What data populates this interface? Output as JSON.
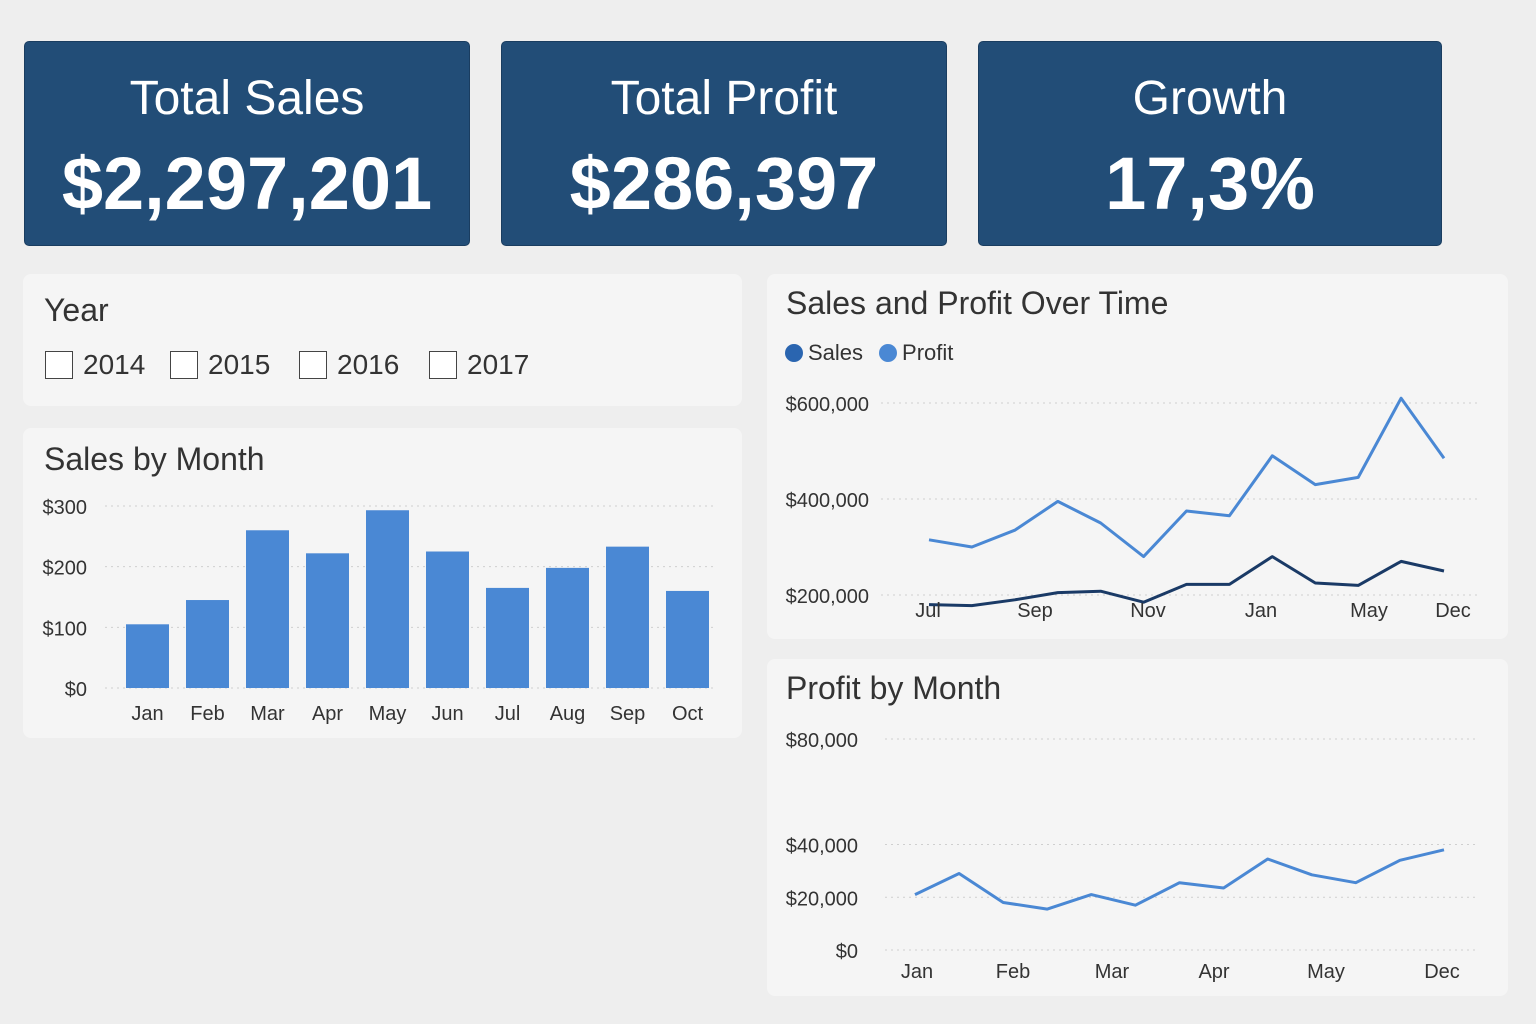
{
  "kpis": [
    {
      "label": "Total Sales",
      "value": "$2,297,201"
    },
    {
      "label": "Total Profit",
      "value": "$286,397"
    },
    {
      "label": "Growth",
      "value": "17,3%"
    }
  ],
  "year_filter": {
    "title": "Year",
    "options": [
      {
        "label": "2014",
        "checked": false
      },
      {
        "label": "2015",
        "checked": false
      },
      {
        "label": "2016",
        "checked": false
      },
      {
        "label": "2017",
        "checked": false
      }
    ]
  },
  "colors": {
    "kpi_bg": "#224d77",
    "bar": "#4a88d4",
    "sales_line": "#4a88d4",
    "profit_line": "#1a3a66",
    "legend_sales": "#2a65b0",
    "legend_profit": "#4a88d4"
  },
  "chart_data": [
    {
      "type": "bar",
      "title": "Sales by Month",
      "categories": [
        "Jan",
        "Feb",
        "Mar",
        "Apr",
        "May",
        "Jun",
        "Jul",
        "Aug",
        "Sep",
        "Oct"
      ],
      "values": [
        105,
        145,
        260,
        222,
        293,
        225,
        165,
        198,
        233,
        160
      ],
      "yticks": [
        "$0",
        "$100",
        "$200",
        "$300"
      ],
      "ylim": [
        0,
        300
      ],
      "grid": true
    },
    {
      "type": "line",
      "title": "Sales and Profit Over Time",
      "legend": [
        "Sales",
        "Profit"
      ],
      "legend_position": "top-left",
      "xticks": [
        "Jul",
        "Sep",
        "Nov",
        "Jan",
        "May",
        "Dec"
      ],
      "series": [
        {
          "name": "Sales",
          "values": [
            315000,
            300000,
            335000,
            395000,
            350000,
            280000,
            375000,
            365000,
            490000,
            430000,
            445000,
            610000,
            485000
          ]
        },
        {
          "name": "Profit",
          "values": [
            180000,
            178000,
            190000,
            205000,
            208000,
            185000,
            222000,
            222000,
            280000,
            225000,
            220000,
            270000,
            250000
          ]
        }
      ],
      "yticks": [
        "$200,000",
        "$400,000",
        "$600,000"
      ],
      "ylim": [
        100000,
        600000
      ],
      "grid": true
    },
    {
      "type": "line",
      "title": "Profit by Month",
      "xticks": [
        "Jan",
        "Feb",
        "Mar",
        "Apr",
        "May",
        "Dec"
      ],
      "series": [
        {
          "name": "Profit",
          "values": [
            21000,
            29000,
            18000,
            15500,
            21000,
            17000,
            25500,
            23500,
            34500,
            28500,
            25500,
            34000,
            38000
          ]
        }
      ],
      "yticks": [
        "$0",
        "$20,000",
        "$40,000",
        "$80,000"
      ],
      "ylim": [
        0,
        80000
      ],
      "grid": true
    }
  ]
}
